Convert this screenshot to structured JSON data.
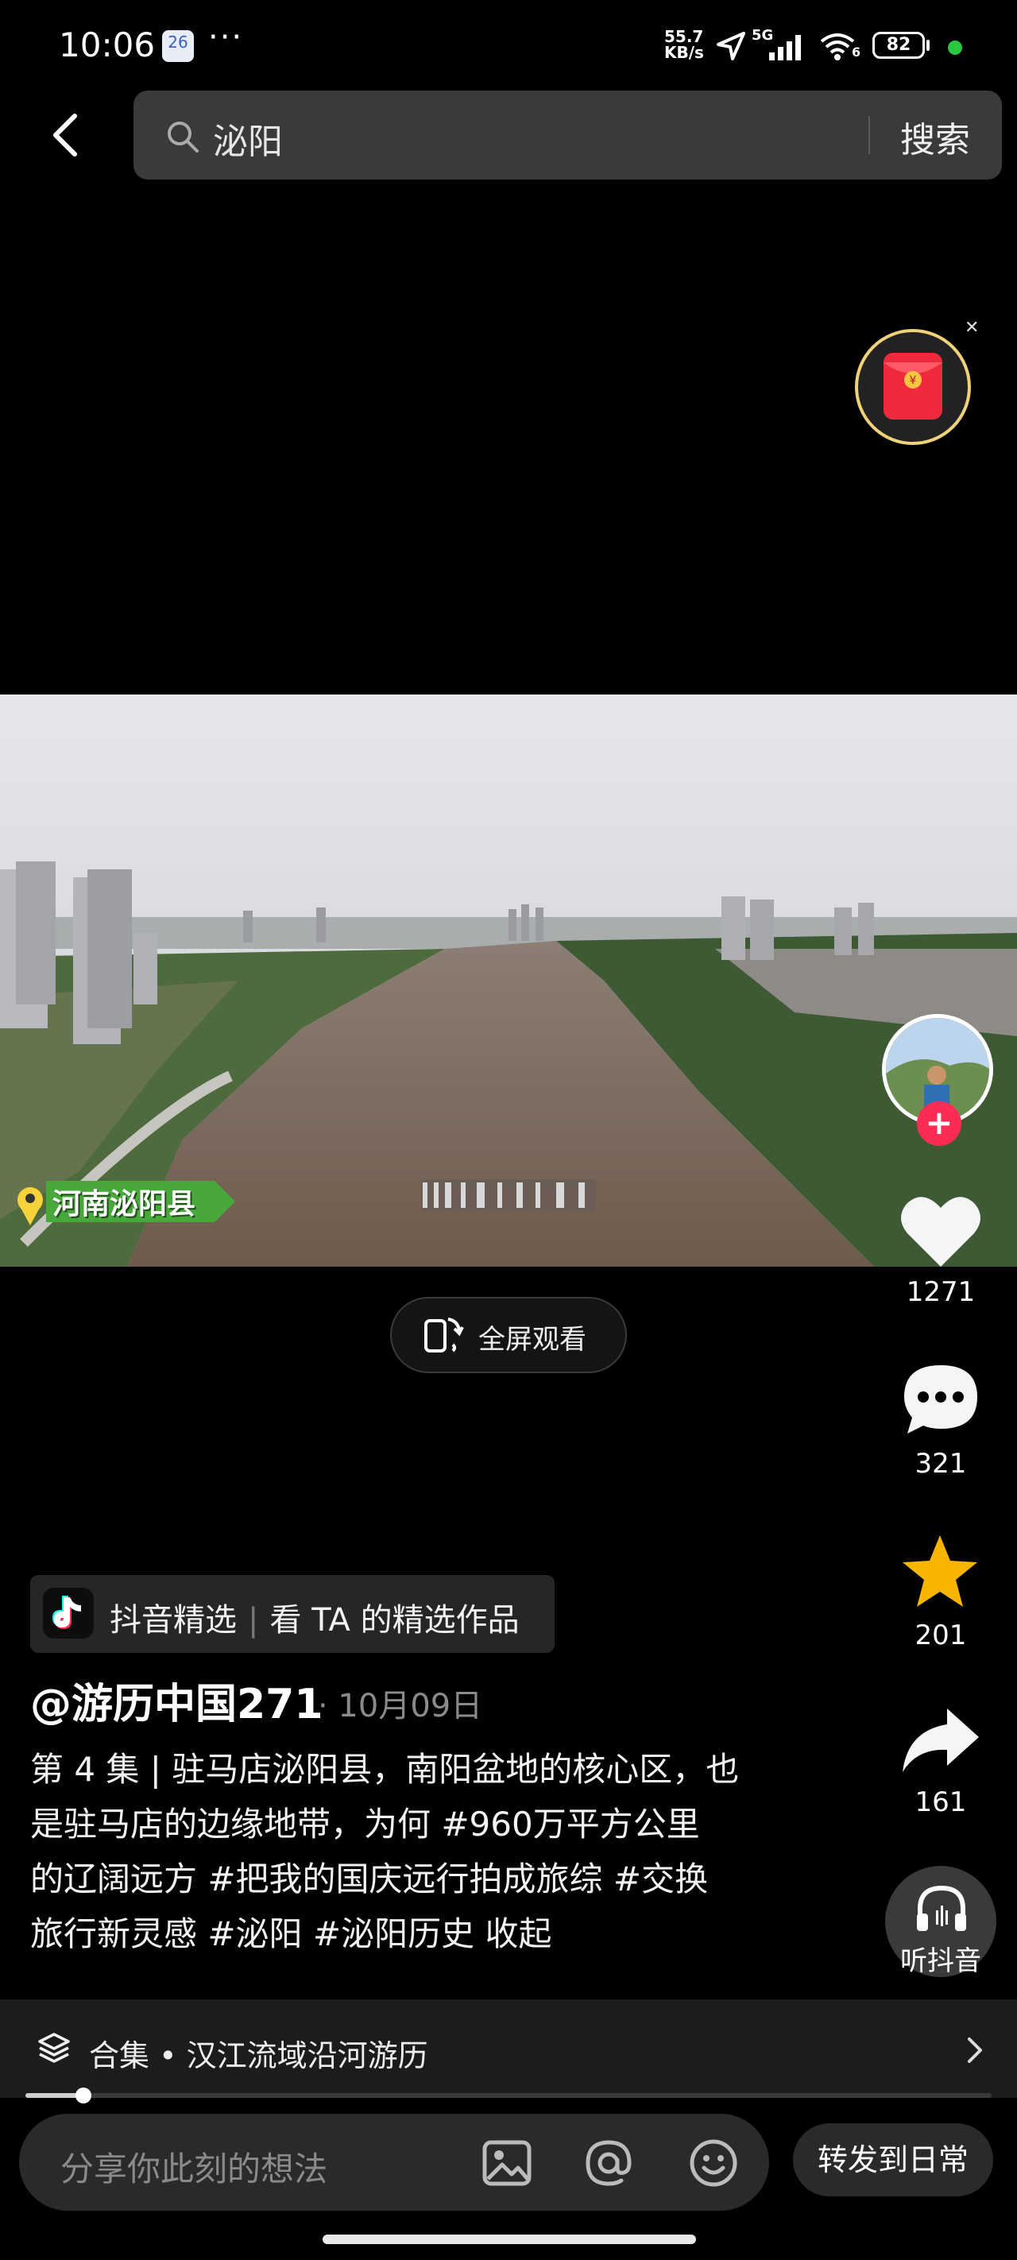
{
  "status_bar": {
    "time": "10:06",
    "calendar_day": "26",
    "net_speed_value": "55.7",
    "net_speed_unit": "KB/s",
    "network_type": "5G",
    "wifi_badge": "6",
    "battery": "82"
  },
  "search": {
    "query": "泌阳",
    "button": "搜索"
  },
  "video": {
    "location_badge": "河南泌阳县"
  },
  "fullscreen_label": "全屏观看",
  "actions": {
    "likes": "1271",
    "comments": "321",
    "favorites": "201",
    "shares": "161",
    "listen": "听抖音"
  },
  "featured": {
    "source": "抖音精选",
    "link": "看 TA 的精选作品"
  },
  "post": {
    "author": "@游历中国271",
    "date": "· 10月09日",
    "description_line1": "第 4 集 | 驻马店泌阳县，南阳盆地的核心区，也",
    "description_line2": "是驻马店的边缘地带，为何 #960万平方公里",
    "description_line3": "的辽阔远方 #把我的国庆远行拍成旅综 #交换",
    "description_line4": "旅行新灵感 #泌阳 #泌阳历史",
    "collapse": "收起"
  },
  "collection": {
    "label": "合集 • 汉江流域沿河游历",
    "progress": 0.06
  },
  "comment_input": {
    "placeholder": "分享你此刻的想法"
  },
  "share_daily": "转发到日常",
  "colors": {
    "accent_red": "#fe2c55",
    "star": "#f7b500",
    "background": "#000000"
  }
}
